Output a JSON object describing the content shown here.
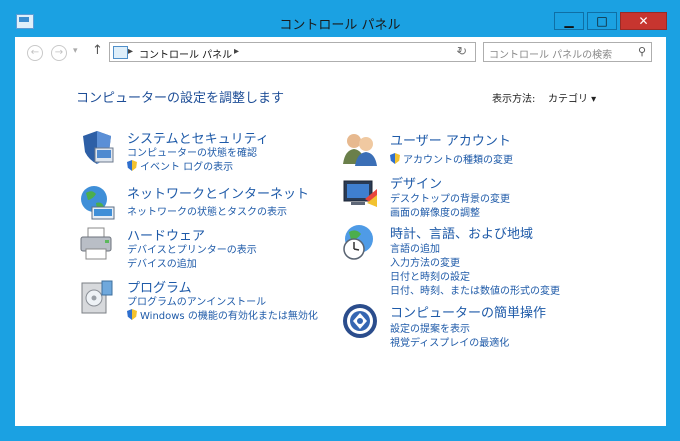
{
  "window": {
    "title": "コントロール パネル",
    "buttons": {
      "minimize": "▁",
      "maximize": "□",
      "close": "✕"
    }
  },
  "navigation": {
    "back": "←",
    "forward": "→",
    "recent": "▾",
    "up": "↑",
    "address": {
      "path": "コントロール パネル",
      "sep": "▸",
      "dropdown": "⌄",
      "refresh": "↻"
    },
    "search": {
      "placeholder": "コントロール パネルの検索",
      "icon": "⚲"
    }
  },
  "main": {
    "heading": "コンピューターの設定を調整します",
    "view_by": {
      "label": "表示方法:",
      "value": "カテゴリ ▾"
    }
  },
  "categories": [
    {
      "title": "システムとセキュリティ",
      "links": [
        {
          "text": "コンピューターの状態を確認",
          "shield": false
        },
        {
          "text": "イベント ログの表示",
          "shield": true
        }
      ]
    },
    {
      "title": "ネットワークとインターネット",
      "links": [
        {
          "text": "ネットワークの状態とタスクの表示",
          "shield": false
        }
      ]
    },
    {
      "title": "ハードウェア",
      "links": [
        {
          "text": "デバイスとプリンターの表示",
          "shield": false
        },
        {
          "text": "デバイスの追加",
          "shield": false
        }
      ]
    },
    {
      "title": "プログラム",
      "links": [
        {
          "text": "プログラムのアンインストール",
          "shield": false
        },
        {
          "text": "Windows の機能の有効化または無効化",
          "shield": true
        }
      ]
    },
    {
      "title": "ユーザー アカウント",
      "links": [
        {
          "text": "アカウントの種類の変更",
          "shield": true
        }
      ]
    },
    {
      "title": "デザイン",
      "links": [
        {
          "text": "デスクトップの背景の変更",
          "shield": false
        },
        {
          "text": "画面の解像度の調整",
          "shield": false
        }
      ]
    },
    {
      "title": "時計、言語、および地域",
      "links": [
        {
          "text": "言語の追加",
          "shield": false
        },
        {
          "text": "入力方法の変更",
          "shield": false
        },
        {
          "text": "日付と時刻の設定",
          "shield": false
        },
        {
          "text": "日付、時刻、または数値の形式の変更",
          "shield": false
        }
      ]
    },
    {
      "title": "コンピューターの簡単操作",
      "links": [
        {
          "text": "設定の提案を表示",
          "shield": false
        },
        {
          "text": "視覚ディスプレイの最適化",
          "shield": false
        }
      ]
    }
  ]
}
